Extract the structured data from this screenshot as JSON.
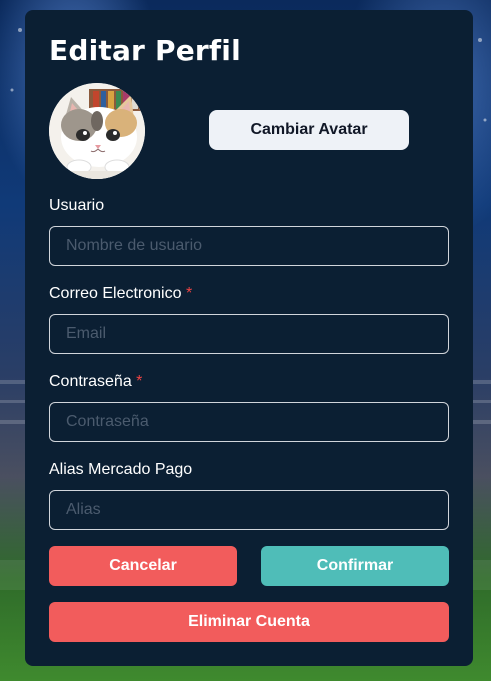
{
  "form": {
    "title": "Editar Perfil",
    "change_avatar_label": "Cambiar Avatar",
    "fields": {
      "username": {
        "label": "Usuario",
        "required": false,
        "placeholder": "Nombre de usuario",
        "value": ""
      },
      "email": {
        "label": "Correo Electronico",
        "required": true,
        "placeholder": "Email",
        "value": ""
      },
      "password": {
        "label": "Contraseña",
        "required": true,
        "placeholder": "Contraseña",
        "value": ""
      },
      "alias": {
        "label": "Alias Mercado Pago",
        "required": false,
        "placeholder": "Alias",
        "value": ""
      }
    },
    "required_marker": "*",
    "buttons": {
      "cancel": "Cancelar",
      "confirm": "Confirmar",
      "delete": "Eliminar Cuenta"
    }
  },
  "colors": {
    "card_background": "#0b1f33",
    "cancel": "#f25c5c",
    "confirm": "#4fbdb8",
    "delete": "#f25c5c",
    "required_marker": "#ef4444"
  },
  "avatar": {
    "icon": "kitten-avatar"
  },
  "background": {
    "icon": "stadium-background"
  }
}
